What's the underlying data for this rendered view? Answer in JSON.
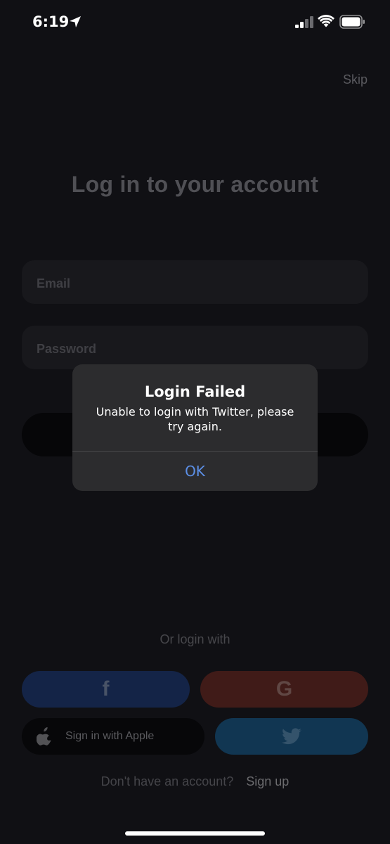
{
  "status_bar": {
    "time": "6:19",
    "icons": [
      "location-arrow-icon",
      "signal-icon",
      "wifi-icon",
      "battery-icon"
    ]
  },
  "skip_label": "Skip",
  "title": "Log in to your account",
  "email": {
    "placeholder": "Email",
    "value": ""
  },
  "password": {
    "placeholder": "Password",
    "value": ""
  },
  "or_login_with": "Or login with",
  "social": {
    "facebook_icon": "f",
    "google_icon": "G",
    "apple_label": "Sign in with Apple",
    "twitter_icon": "twitter-bird-icon"
  },
  "signup": {
    "question": "Don't have an account?",
    "link": "Sign up"
  },
  "alert": {
    "title": "Login Failed",
    "message": "Unable to login with Twitter, please try again.",
    "ok_label": "OK"
  },
  "colors": {
    "background": "#1c1c23",
    "facebook": "#233f7a",
    "google": "#6f2f2a",
    "twitter": "#1e5e8d",
    "alert_background": "#2c2c2e",
    "alert_button": "#5c8fe6"
  }
}
